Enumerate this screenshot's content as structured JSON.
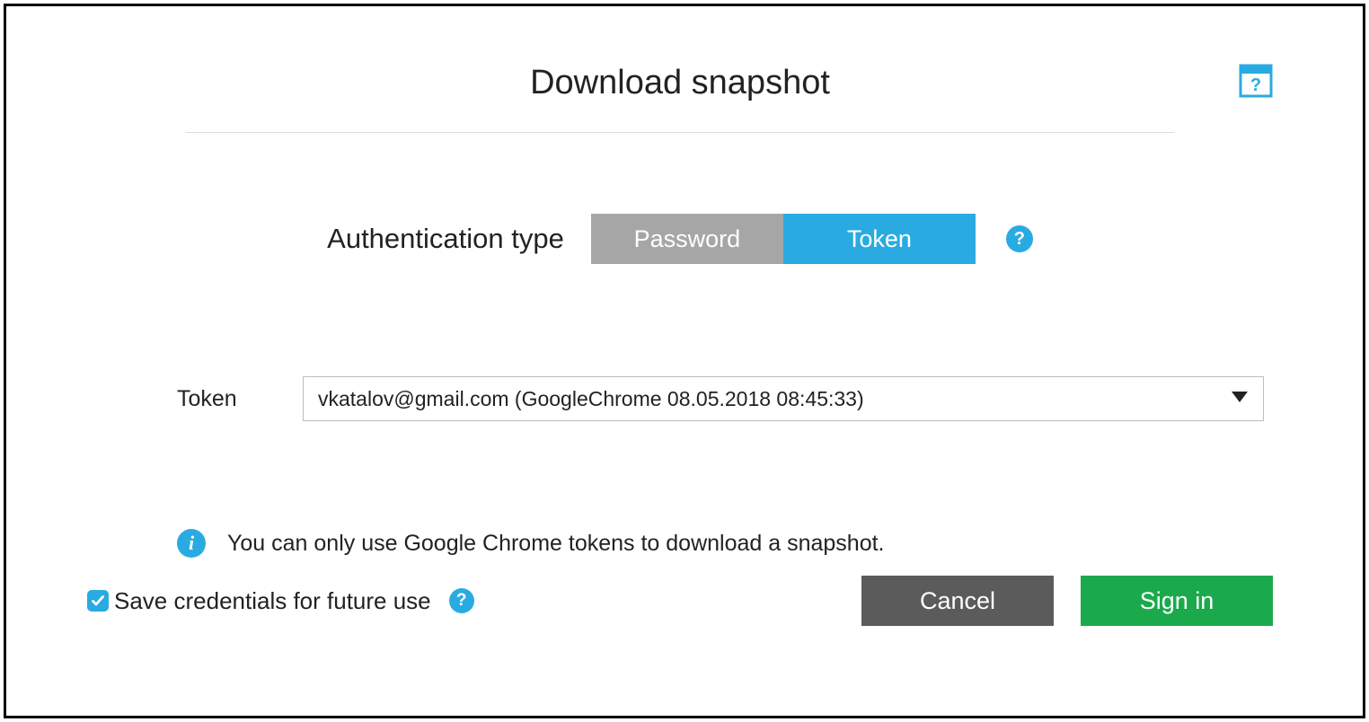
{
  "dialog": {
    "title": "Download snapshot"
  },
  "auth": {
    "label": "Authentication type",
    "options": {
      "password": "Password",
      "token": "Token"
    },
    "selected": "token"
  },
  "token": {
    "label": "Token",
    "selected_value": "vkatalov@gmail.com (GoogleChrome 08.05.2018 08:45:33)"
  },
  "info": {
    "text": "You can only use Google Chrome tokens to download a snapshot."
  },
  "save_credentials": {
    "label": "Save credentials for future use",
    "checked": true
  },
  "buttons": {
    "cancel": "Cancel",
    "signin": "Sign in"
  },
  "colors": {
    "accent": "#29abe2",
    "inactive": "#a6a6a6",
    "cancel": "#5b5b5b",
    "signin": "#1aaa4c"
  }
}
